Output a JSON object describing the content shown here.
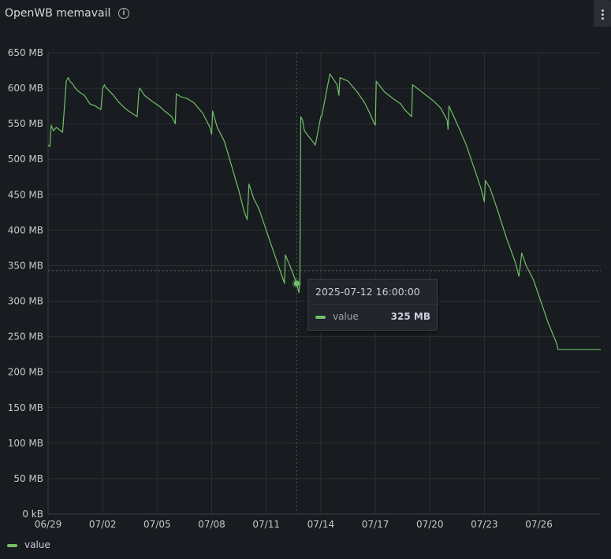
{
  "panel": {
    "title": "OpenWB memavail",
    "info_icon": "info-circle-icon",
    "menu_icon": "kebab-menu-icon"
  },
  "tooltip": {
    "time": "2025-07-12 16:00:00",
    "series": "value",
    "value": "325 MB"
  },
  "legend": {
    "items": [
      {
        "label": "value",
        "color": "#73bf69"
      }
    ]
  },
  "chart_data": {
    "type": "line",
    "title": "OpenWB memavail",
    "x_unit": "days since 06/29 00:00",
    "y_unit": "MB",
    "xlim": [
      0,
      30.4
    ],
    "ylim": [
      0,
      650
    ],
    "yticks": [
      0,
      50,
      100,
      150,
      200,
      250,
      300,
      350,
      400,
      450,
      500,
      550,
      600,
      650
    ],
    "ytick_labels": [
      "0 kB",
      "50 MB",
      "100 MB",
      "150 MB",
      "200 MB",
      "250 MB",
      "300 MB",
      "350 MB",
      "400 MB",
      "450 MB",
      "500 MB",
      "550 MB",
      "600 MB",
      "650 MB"
    ],
    "xticks": [
      0,
      3,
      6,
      9,
      12,
      15,
      18,
      21,
      24,
      27
    ],
    "xtick_labels": [
      "06/29",
      "07/02",
      "07/05",
      "07/08",
      "07/11",
      "07/14",
      "07/17",
      "07/20",
      "07/23",
      "07/26"
    ],
    "grid": true,
    "legend_position": "bottom-left",
    "hover": {
      "x": 13.67,
      "y": 325,
      "crosshair_y": 343
    },
    "series": [
      {
        "name": "value",
        "color": "#73bf69",
        "x": [
          0.0,
          0.1,
          0.17,
          0.3,
          0.45,
          0.6,
          0.8,
          1.0,
          1.1,
          1.15,
          1.2,
          1.35,
          1.5,
          1.7,
          2.0,
          2.3,
          2.6,
          2.9,
          3.0,
          3.1,
          3.15,
          3.3,
          3.6,
          3.9,
          4.3,
          4.6,
          4.9,
          5.0,
          5.05,
          5.3,
          5.7,
          6.1,
          6.4,
          6.8,
          7.0,
          7.05,
          7.3,
          7.6,
          8.0,
          8.5,
          8.9,
          9.0,
          9.05,
          9.3,
          9.7,
          10.1,
          10.5,
          10.8,
          10.95,
          11.0,
          11.05,
          11.3,
          11.6,
          12.0,
          12.4,
          12.8,
          13.0,
          13.05,
          13.3,
          13.6,
          13.67,
          13.8,
          13.85,
          13.9,
          14.0,
          14.1,
          14.4,
          14.7,
          15.0,
          15.05,
          15.5,
          15.9,
          16.0,
          16.05,
          16.5,
          17.0,
          17.4,
          17.6,
          17.95,
          18.0,
          18.05,
          18.5,
          19.0,
          19.4,
          19.6,
          20.0,
          20.05,
          20.4,
          20.8,
          21.2,
          21.6,
          21.95,
          22.0,
          22.05,
          22.5,
          23.0,
          23.4,
          23.8,
          24.0,
          24.05,
          24.3,
          24.7,
          25.2,
          25.7,
          25.9,
          26.0,
          26.05,
          26.3,
          26.7,
          27.1,
          27.5,
          27.9,
          28.0,
          28.05,
          28.3,
          28.7,
          29.1,
          29.5,
          29.9,
          30.3,
          30.4
        ],
        "y": [
          520,
          518,
          548,
          540,
          545,
          542,
          538,
          610,
          615,
          613,
          610,
          606,
          600,
          595,
          590,
          578,
          575,
          570,
          600,
          605,
          602,
          598,
          590,
          580,
          570,
          565,
          560,
          598,
          600,
          590,
          582,
          575,
          568,
          560,
          550,
          592,
          588,
          586,
          580,
          565,
          545,
          535,
          568,
          545,
          525,
          490,
          455,
          425,
          415,
          440,
          465,
          445,
          430,
          400,
          370,
          340,
          325,
          365,
          350,
          330,
          325,
          312,
          330,
          560,
          555,
          540,
          530,
          520,
          560,
          560,
          620,
          605,
          590,
          615,
          610,
          595,
          580,
          570,
          550,
          548,
          610,
          595,
          585,
          578,
          570,
          560,
          605,
          598,
          590,
          582,
          572,
          555,
          542,
          575,
          550,
          520,
          490,
          460,
          440,
          470,
          460,
          430,
          390,
          355,
          335,
          355,
          368,
          350,
          330,
          300,
          270,
          245,
          238,
          232,
          232,
          232,
          232,
          232,
          232,
          232,
          232
        ]
      }
    ]
  }
}
